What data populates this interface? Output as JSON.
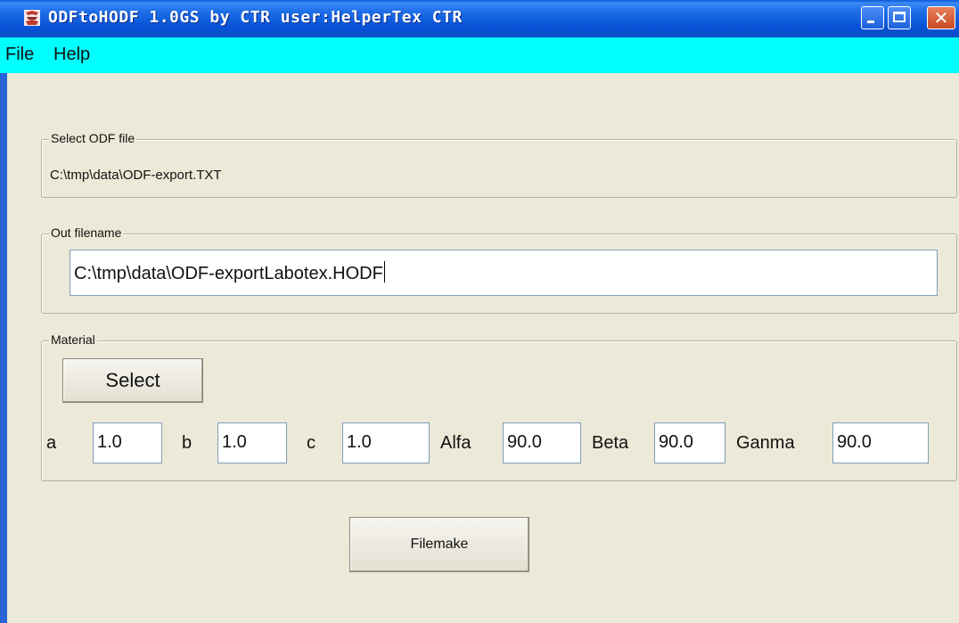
{
  "window": {
    "title": "ODFtoHODF 1.0GS by CTR  user:HelperTex CTR"
  },
  "menu": {
    "file": "File",
    "help": "Help"
  },
  "select_odf": {
    "legend": "Select ODF file",
    "path": "C:\\tmp\\data\\ODF-export.TXT"
  },
  "out_filename": {
    "legend": "Out filename",
    "value": "C:\\tmp\\data\\ODF-exportLabotex.HODF"
  },
  "material": {
    "legend": "Material",
    "select_label": "Select",
    "params": {
      "a_label": "a",
      "a_value": "1.0",
      "b_label": "b",
      "b_value": "1.0",
      "c_label": "c",
      "c_value": "1.0",
      "alfa_label": "Alfa",
      "alfa_value": "90.0",
      "beta_label": "Beta",
      "beta_value": "90.0",
      "ganma_label": "Ganma",
      "ganma_value": "90.0"
    }
  },
  "actions": {
    "filemake_label": "Filemake"
  },
  "colors": {
    "titlebar": "#0a58d8",
    "menubar": "#00ffff",
    "background": "#ece9d8",
    "close_button": "#c84a23"
  }
}
